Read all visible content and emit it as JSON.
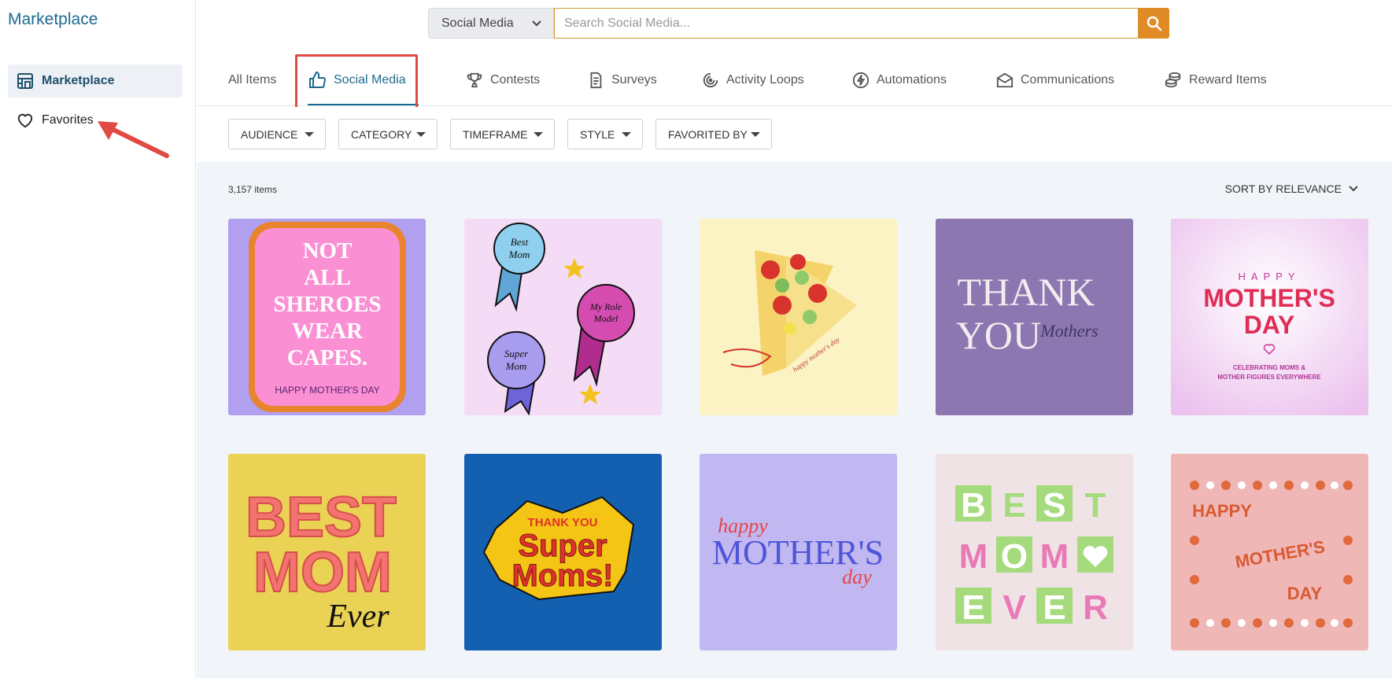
{
  "sidebar": {
    "title": "Marketplace",
    "items": [
      {
        "label": "Marketplace",
        "icon": "store-icon",
        "active": true
      },
      {
        "label": "Favorites",
        "icon": "heart-icon",
        "active": false
      }
    ]
  },
  "search": {
    "category": "Social Media",
    "placeholder": "Search Social Media..."
  },
  "tabs": [
    {
      "label": "All Items",
      "icon": ""
    },
    {
      "label": "Social Media",
      "icon": "thumbs-up-icon"
    },
    {
      "label": "Contests",
      "icon": "trophy-icon"
    },
    {
      "label": "Surveys",
      "icon": "clipboard-icon"
    },
    {
      "label": "Activity Loops",
      "icon": "loop-icon"
    },
    {
      "label": "Automations",
      "icon": "bolt-icon"
    },
    {
      "label": "Communications",
      "icon": "envelope-icon"
    },
    {
      "label": "Reward Items",
      "icon": "coins-icon"
    }
  ],
  "filters": [
    "AUDIENCE",
    "CATEGORY",
    "TIMEFRAME",
    "STYLE",
    "FAVORITED BY"
  ],
  "results": {
    "count": "3,157 items",
    "sort": "SORT BY RELEVANCE"
  },
  "cards": [
    {
      "text": [
        "NOT",
        "ALL",
        "SHEROES",
        "WEAR",
        "CAPES.",
        "HAPPY MOTHER'S DAY"
      ],
      "bg": "#b19ff0"
    },
    {
      "text": [
        "Best",
        "Mom",
        "My Role",
        "Model",
        "Super",
        "Mom"
      ],
      "bg": "#f4dcf7"
    },
    {
      "text": [
        "happy mother's day"
      ],
      "bg": "#fbf3c3"
    },
    {
      "text": [
        "THANK",
        "YOU",
        "Mothers"
      ],
      "bg": "#8c77b1"
    },
    {
      "text": [
        "HAPPY",
        "MOTHER'S",
        "DAY",
        "CELEBRATING MOMS &",
        "MOTHER FIGURES EVERYWHERE"
      ],
      "bg": "#f3d9f3"
    },
    {
      "text": [
        "BEST",
        "MOM",
        "Ever"
      ],
      "bg": "#ead254"
    },
    {
      "text": [
        "THANK YOU",
        "Super",
        "Moms!"
      ],
      "bg": "#1460b0"
    },
    {
      "text": [
        "happy",
        "MOTHER'S",
        "day"
      ],
      "bg": "#c1b8f1"
    },
    {
      "text": [
        "B",
        "E",
        "S",
        "T",
        "M",
        "O",
        "M",
        "E",
        "V",
        "E",
        "R"
      ],
      "bg": "#efe3e6"
    },
    {
      "text": [
        "HAPPY",
        "MOTHER'S",
        "DAY"
      ],
      "bg": "#f0b7b7"
    }
  ]
}
